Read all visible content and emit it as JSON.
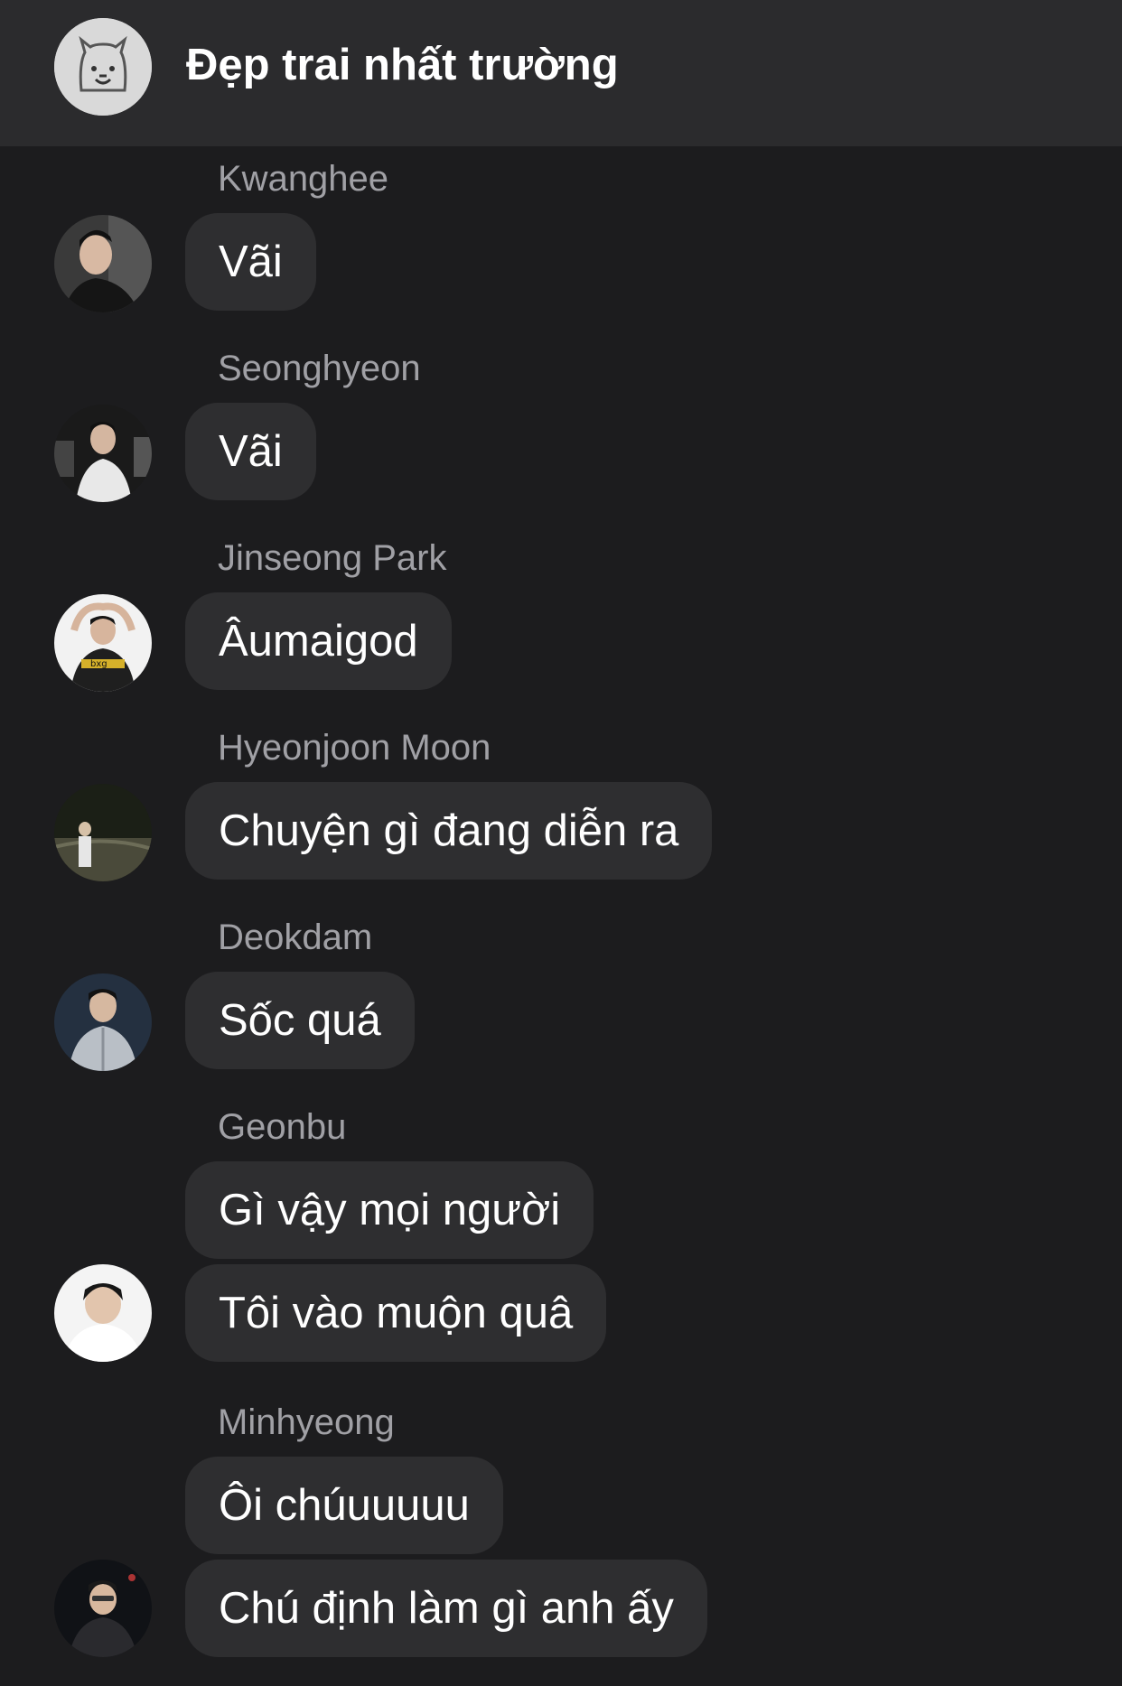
{
  "chat": {
    "title": "Đẹp trai nhất trường",
    "group_avatar_icon": "alpaca-icon"
  },
  "messages": [
    {
      "sender": "Kwanghee",
      "texts": [
        "Vãi"
      ]
    },
    {
      "sender": "Seonghyeon",
      "texts": [
        "Vãi"
      ]
    },
    {
      "sender": "Jinseong Park",
      "texts": [
        "Âumaigod"
      ]
    },
    {
      "sender": "Hyeonjoon Moon",
      "texts": [
        "Chuyện gì đang diễn ra"
      ]
    },
    {
      "sender": "Deokdam",
      "texts": [
        "Sốc quá"
      ]
    },
    {
      "sender": "Geonbu",
      "texts": [
        "Gì vậy mọi người",
        "Tôi vào muộn quâ"
      ]
    },
    {
      "sender": "Minhyeong",
      "texts": [
        "Ôi chúuuuuu",
        "Chú định làm gì anh ấy"
      ]
    }
  ],
  "colors": {
    "background": "#1c1c1e",
    "header": "#2b2b2d",
    "bubble": "#2e2e30",
    "sender_name": "#a0a0a5",
    "text": "#ffffff"
  }
}
